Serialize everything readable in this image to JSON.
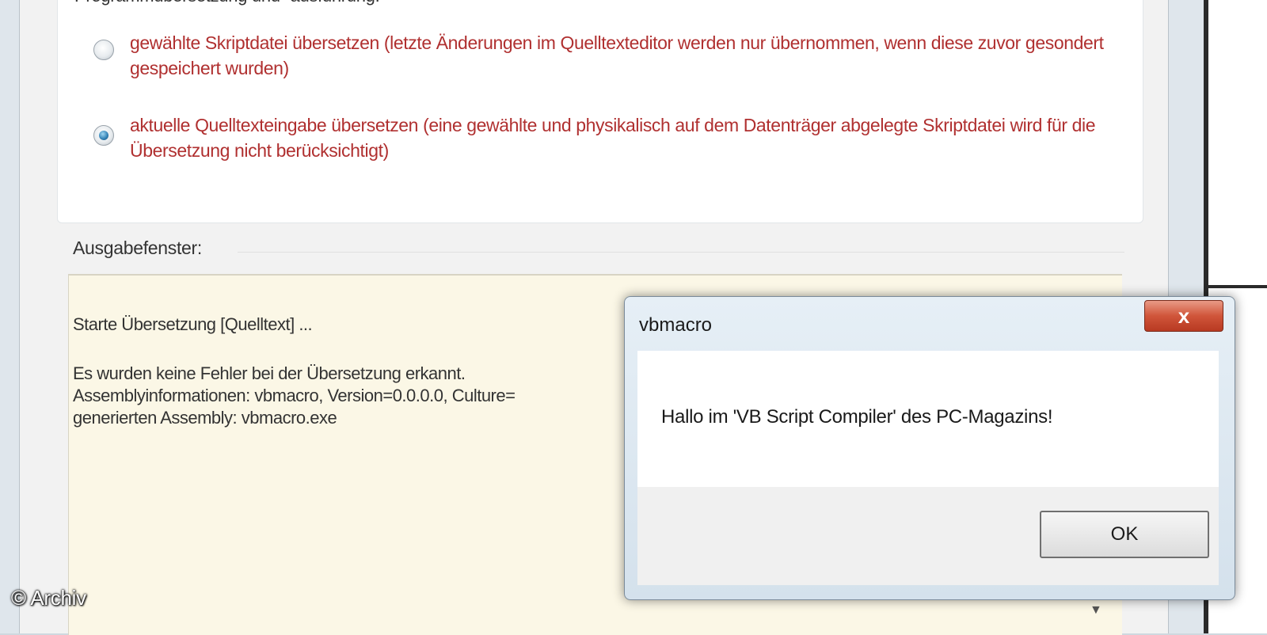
{
  "options": {
    "caption": "Programmübersetzung und -ausführung:",
    "radio1_label": "gewählte Skriptdatei übersetzen (letzte Änderungen im Quelltexteditor werden nur übernommen, wenn diese zuvor gesondert gespeichert wurden)",
    "radio1_checked": false,
    "radio2_label": "aktuelle Quelltexteingabe übersetzen (eine gewählte und physikalisch auf dem Datenträger abgelegte Skriptdatei wird für die Übersetzung nicht berücksichtigt)",
    "radio2_checked": true
  },
  "output": {
    "label": "Ausgabefenster:",
    "lines": [
      "Starte Übersetzung [Quelltext] ...",
      "Es wurden keine Fehler bei der Übersetzung erkannt.",
      "Assemblyinformationen: vbmacro, Version=0.0.0.0, Culture=",
      "generierten Assembly: vbmacro.exe"
    ]
  },
  "dialog": {
    "title": "vbmacro",
    "close_label": "x",
    "message": "Hallo im 'VB Script Compiler' des PC-Magazins!",
    "ok_label": "OK"
  },
  "watermark": "© Archiv",
  "colors": {
    "option_text": "#b03030",
    "output_bg": "#fbf7e6",
    "close_button": "#d0553a"
  }
}
